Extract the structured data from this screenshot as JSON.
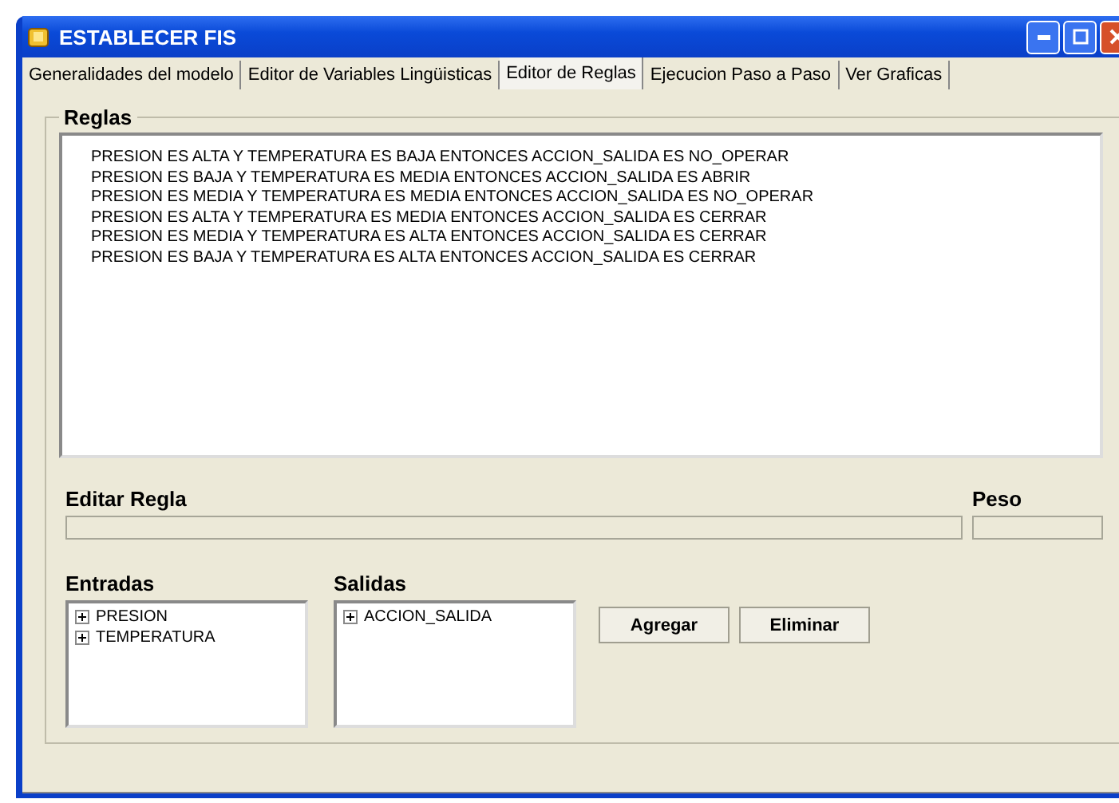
{
  "window": {
    "title": "ESTABLECER FIS"
  },
  "tabs": [
    {
      "label": "Generalidades del modelo",
      "selected": false
    },
    {
      "label": "Editor de Variables Lingüisticas",
      "selected": false
    },
    {
      "label": "Editor de Reglas",
      "selected": true
    },
    {
      "label": "Ejecucion Paso a Paso",
      "selected": false
    },
    {
      "label": "Ver Graficas",
      "selected": false
    }
  ],
  "rules_group": {
    "title": "Reglas",
    "rules": [
      "PRESION ES ALTA Y TEMPERATURA ES BAJA ENTONCES ACCION_SALIDA ES NO_OPERAR",
      "PRESION ES BAJA Y TEMPERATURA ES MEDIA ENTONCES ACCION_SALIDA ES ABRIR",
      "PRESION ES MEDIA Y TEMPERATURA ES MEDIA ENTONCES ACCION_SALIDA ES NO_OPERAR",
      "PRESION ES ALTA Y TEMPERATURA ES MEDIA ENTONCES ACCION_SALIDA ES CERRAR",
      "PRESION ES MEDIA Y TEMPERATURA ES ALTA ENTONCES ACCION_SALIDA ES CERRAR",
      "PRESION ES BAJA Y TEMPERATURA ES ALTA ENTONCES ACCION_SALIDA ES CERRAR"
    ],
    "edit_label": "Editar Regla",
    "weight_label": "Peso",
    "inputs": {
      "label": "Entradas",
      "items": [
        {
          "label": "PRESION",
          "expanded": false
        },
        {
          "label": "TEMPERATURA",
          "expanded": false
        }
      ]
    },
    "outputs": {
      "label": "Salidas",
      "items": [
        {
          "label": "ACCION_SALIDA",
          "expanded": false
        }
      ]
    },
    "buttons": [
      "Agregar",
      "Eliminar"
    ]
  }
}
